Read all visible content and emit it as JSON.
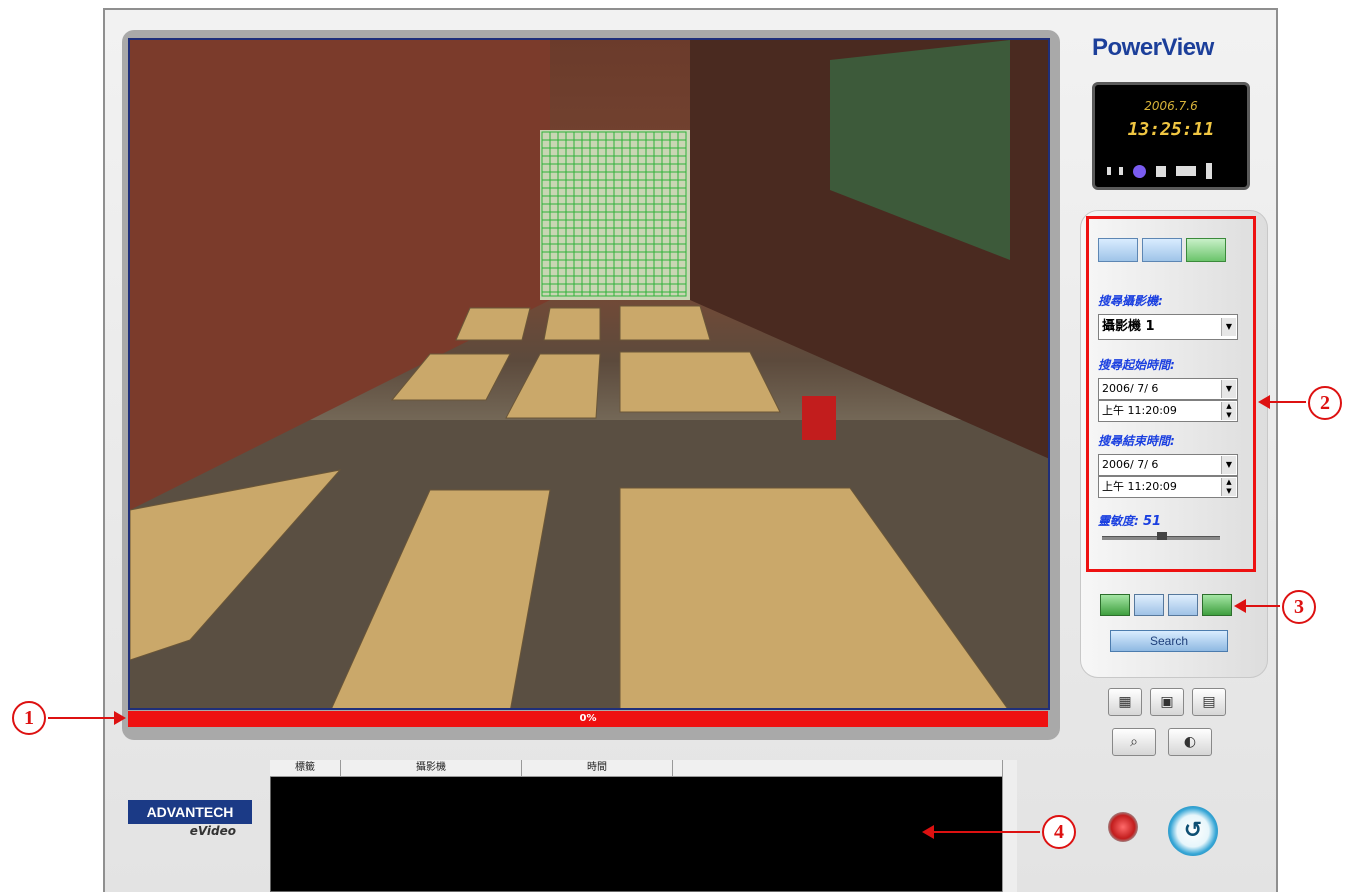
{
  "header": {
    "brand": "PowerView"
  },
  "clock": {
    "date": "2006.7.6",
    "time": "13:25:11"
  },
  "search_panel": {
    "camera_label": "搜尋攝影機:",
    "camera_value": "攝影機 1",
    "start_label": "搜尋起始時間:",
    "start_date": "2006/ 7/ 6",
    "start_time": "上午 11:20:09",
    "end_label": "搜尋結束時間:",
    "end_date": "2006/ 7/ 6",
    "end_time": "上午 11:20:09",
    "sensitivity_label": "靈敏度:",
    "sensitivity_value": "51",
    "sensitivity_fraction": 0.51,
    "search_button": "Search"
  },
  "progress": {
    "text": "0%"
  },
  "results": {
    "columns": [
      "標籤",
      "攝影機",
      "時間"
    ]
  },
  "logo": {
    "company": "ADVANTECH",
    "product": "eVideo"
  },
  "callouts": [
    "1",
    "2",
    "3",
    "4"
  ],
  "colors": {
    "accent_red": "#ee1111",
    "brand_blue": "#1c3f9a",
    "label_blue": "#1a3fe0"
  }
}
